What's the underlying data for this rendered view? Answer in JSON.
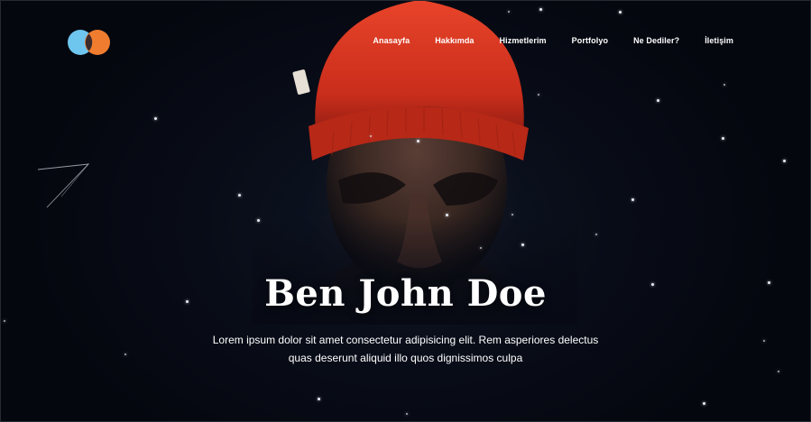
{
  "header": {
    "logo_colors": {
      "left_circle": "#6ec6ef",
      "right_circle": "#f07d2f",
      "overlap": "#3a2a2a"
    },
    "nav": [
      {
        "label": "Anasayfa"
      },
      {
        "label": "Hakkımda"
      },
      {
        "label": "Hizmetlerim"
      },
      {
        "label": "Portfolyo"
      },
      {
        "label": "Ne Dediler?"
      },
      {
        "label": "İletişim"
      }
    ]
  },
  "hero": {
    "title": "Ben John Doe",
    "subtitle_line1": "Lorem ipsum dolor sit amet consectetur adipisicing elit. Rem asperiores delectus",
    "subtitle_line2": "quas deserunt aliquid illo quos dignissimos culpa"
  },
  "colors": {
    "background": "#070a14",
    "beanie": "#d8331e",
    "text": "#ffffff"
  }
}
